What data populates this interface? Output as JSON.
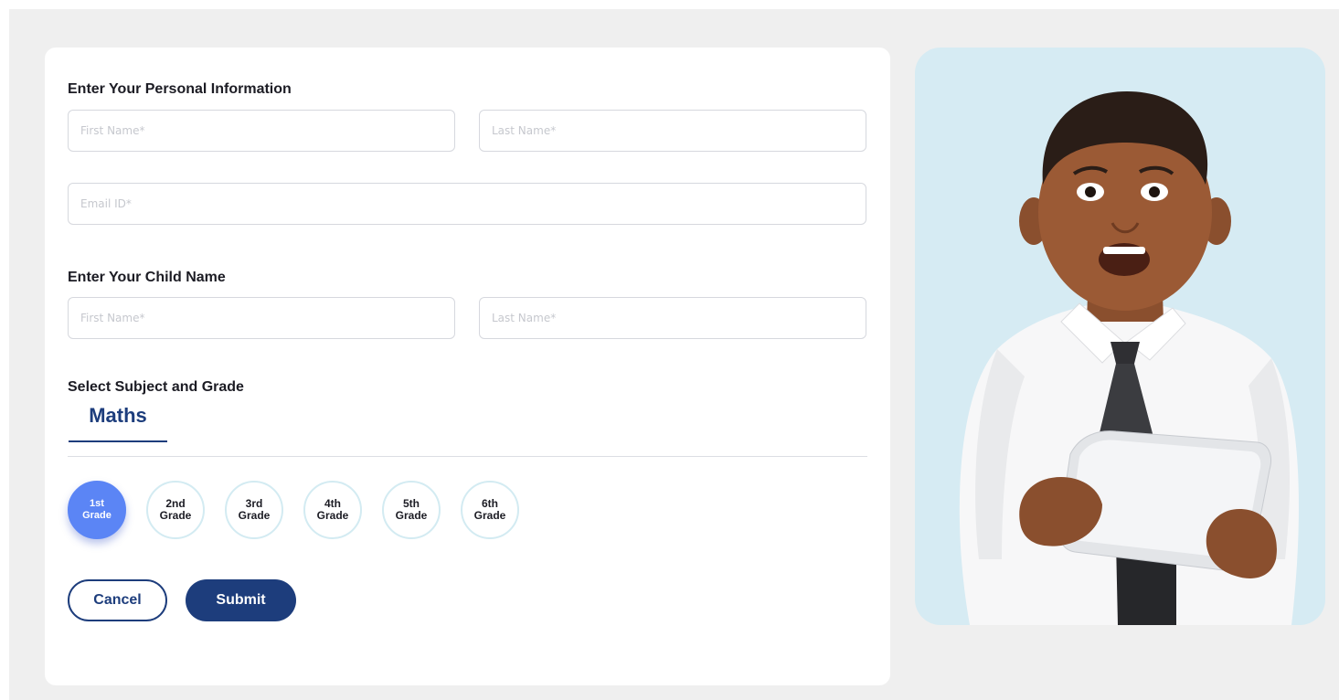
{
  "personal_section": {
    "title": "Enter Your Personal Information",
    "first_name_placeholder": "First Name*",
    "last_name_placeholder": "Last Name*",
    "email_placeholder": "Email ID*"
  },
  "child_section": {
    "title": "Enter Your Child Name",
    "first_name_placeholder": "First Name*",
    "last_name_placeholder": "Last Name*"
  },
  "subject_section": {
    "title": "Select Subject and Grade",
    "tabs": [
      {
        "label": "Maths",
        "active": true
      }
    ],
    "grades": [
      {
        "line1": "1st",
        "line2": "Grade",
        "selected": true
      },
      {
        "line1": "2nd",
        "line2": "Grade",
        "selected": false
      },
      {
        "line1": "3rd",
        "line2": "Grade",
        "selected": false
      },
      {
        "line1": "4th",
        "line2": "Grade",
        "selected": false
      },
      {
        "line1": "5th",
        "line2": "Grade",
        "selected": false
      },
      {
        "line1": "6th",
        "line2": "Grade",
        "selected": false
      }
    ]
  },
  "actions": {
    "cancel_label": "Cancel",
    "submit_label": "Submit"
  },
  "colors": {
    "primary_navy": "#1d3d7c",
    "selected_grade": "#5b85f5",
    "photo_background": "#d6ebf3",
    "page_background": "#efefef"
  }
}
